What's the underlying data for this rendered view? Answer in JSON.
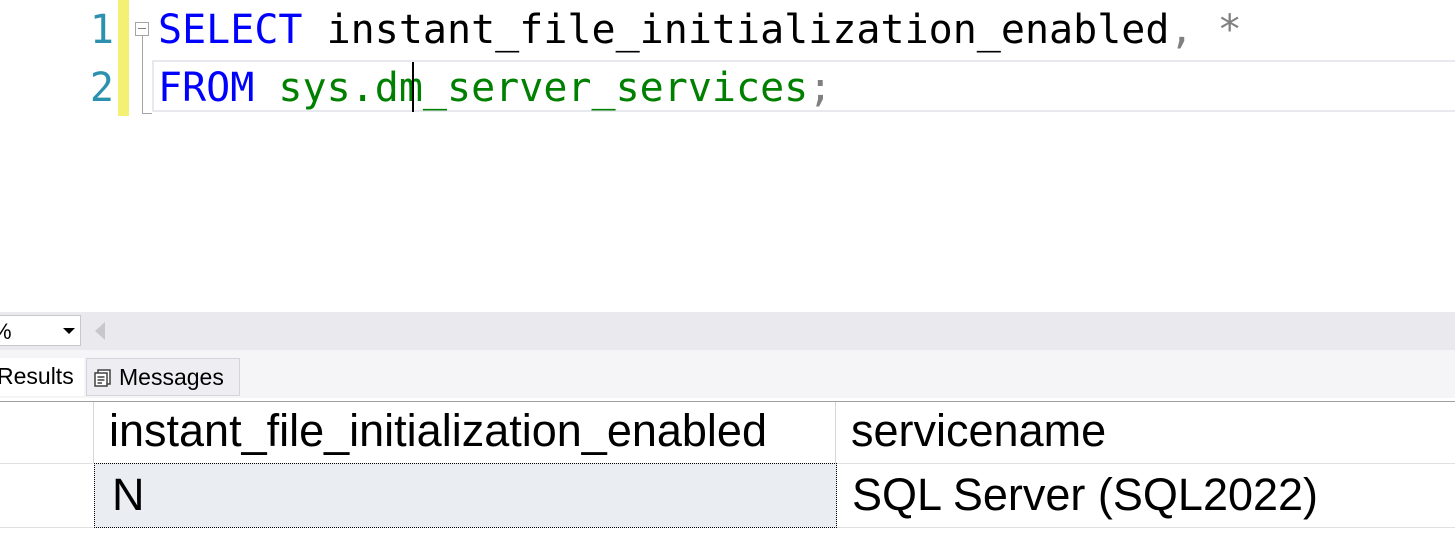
{
  "editor": {
    "line_numbers": [
      "1",
      "2"
    ],
    "line1": {
      "keyword": "SELECT",
      "column": "instant_file_initialization_enabled",
      "comma": ",",
      "star": "*"
    },
    "line2": {
      "keyword": "FROM",
      "object_prefix": "sys.d",
      "object_suffix": "m_server_services",
      "terminator": ";"
    }
  },
  "zoom": {
    "value": "%"
  },
  "tabs": {
    "results": "Results",
    "messages": "Messages"
  },
  "grid": {
    "columns": [
      "instant_file_initialization_enabled",
      "servicename"
    ],
    "rows": [
      [
        "N",
        "SQL Server (SQL2022)"
      ]
    ]
  },
  "colors": {
    "keyword": "#0000ff",
    "system_object": "#008000",
    "line_number": "#2b91af",
    "change_bar": "#f3f074",
    "selected_cell": "#eaeef3"
  },
  "icons": {
    "fold": "collapse-minus-icon",
    "messages_tab": "messages-icon",
    "zoom_dropdown": "chevron-down-icon",
    "scroll_left": "scroll-left-arrow-icon"
  }
}
